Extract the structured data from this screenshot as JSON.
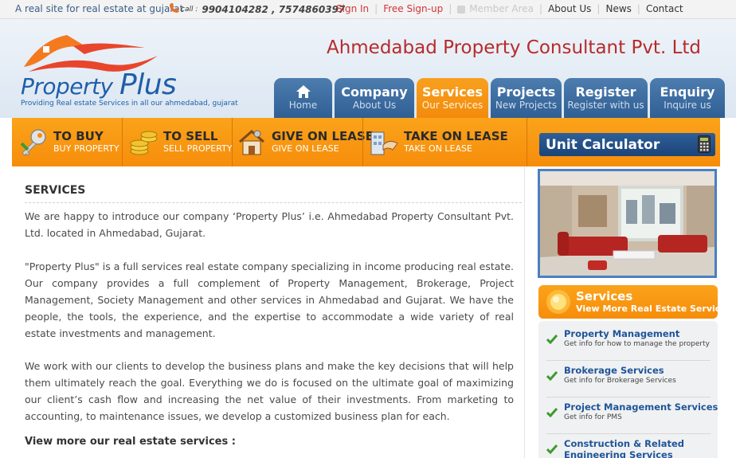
{
  "topbar": {
    "tagline": "A real site for real estate at gujarat",
    "call_label": "call :",
    "phone_numbers": "9904104282 , 7574860397",
    "links": {
      "sign_in": "Sign In",
      "free_signup": "Free Sign-up",
      "member_area": "Member Area",
      "about_us": "About Us",
      "news": "News",
      "contact": "Contact"
    },
    "separator": "|"
  },
  "header": {
    "logo_word_1": "Property ",
    "logo_word_2": "Plus",
    "logo_slogan": "Providing Real estate Services in all our ahmedabad, gujarat",
    "company_name": "Ahmedabad Property Consultant Pvt. Ltd"
  },
  "nav": {
    "home": "Home",
    "company": {
      "title": "Company",
      "sub": "About Us"
    },
    "services": {
      "title": "Services",
      "sub": "Our Services"
    },
    "projects": {
      "title": "Projects",
      "sub": "New Projects"
    },
    "register": {
      "title": "Register",
      "sub": "Register with us"
    },
    "enquiry": {
      "title": "Enquiry",
      "sub": "Inquire us"
    }
  },
  "actions": {
    "buy": {
      "title": "TO BUY",
      "sub": "BUY PROPERTY"
    },
    "sell": {
      "title": "TO SELL",
      "sub": "SELL PROPERTY"
    },
    "give_lease": {
      "title": "GIVE ON LEASE",
      "sub": "GIVE ON LEASE"
    },
    "take_lease": {
      "title": "TAKE ON LEASE",
      "sub": "TAKE ON LEASE"
    },
    "unit_calculator": "Unit Calculator"
  },
  "content": {
    "heading": "SERVICES",
    "para1": "We are happy to introduce our company ‘Property Plus’ i.e. Ahmedabad Property Consultant Pvt. Ltd. located in Ahmedabad, Gujarat.",
    "para2": "\"Property Plus\" is a full services real estate company specializing in income producing real estate. Our company provides a full complement of Property Management, Brokerage, Project Management, Society Management and other services in Ahmedabad and Gujarat. We have the people, the tools, the experience, and the expertise to accommodate a wide variety of real estate investments and management.",
    "para3": "We work with our clients to develop the business plans and make the key decisions that will help them ultimately reach the goal. Everything we do is focused on the ultimate goal of maximizing our client’s cash flow and increasing the net value of their investments. From marketing to accounting, to maintenance issues, we develop a customized business plan for each.",
    "view_more": "View more our real estate services :"
  },
  "sidebar": {
    "services_title": "Services",
    "services_sub": "View More Real Estate Services",
    "items": [
      {
        "title": "Property Management",
        "sub": "Get info for how to manage the property"
      },
      {
        "title": "Brokerage Services",
        "sub": "Get info for Brokerage Services"
      },
      {
        "title": "Project Management Services",
        "sub": "Get info for PMS"
      },
      {
        "title": "Construction & Related",
        "title2": "Engineering Services",
        "sub": ""
      }
    ]
  },
  "colors": {
    "brand_blue": "#2f5f94",
    "brand_orange": "#f68d0b",
    "company_red": "#b62b2b",
    "link_red": "#d2343a"
  },
  "icons": [
    "phone-icon",
    "lock-icon",
    "home-icon",
    "key-icon",
    "coins-icon",
    "house-lease-icon",
    "building-handshake-icon",
    "calculator-icon",
    "sun-icon",
    "check-icon"
  ]
}
